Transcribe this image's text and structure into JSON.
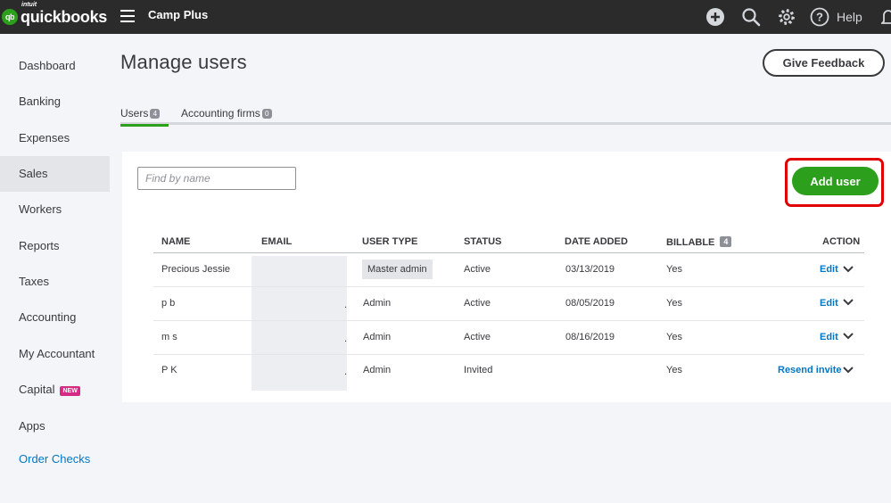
{
  "brand": {
    "intuit": "intuit",
    "name": "quickbooks",
    "mark": "qb"
  },
  "header": {
    "company": "Camp Plus",
    "help_label": "Help"
  },
  "top_icons": [
    "plus-circle-icon",
    "search-icon",
    "gear-icon",
    "help-icon",
    "bell-icon"
  ],
  "sidebar": {
    "items": [
      {
        "label": "Dashboard"
      },
      {
        "label": "Banking"
      },
      {
        "label": "Expenses"
      },
      {
        "label": "Sales",
        "active": true
      },
      {
        "label": "Workers"
      },
      {
        "label": "Reports"
      },
      {
        "label": "Taxes"
      },
      {
        "label": "Accounting"
      },
      {
        "label": "My Accountant"
      },
      {
        "label": "Capital",
        "badge": "NEW"
      },
      {
        "label": "Apps"
      },
      {
        "label": "Order Checks"
      }
    ]
  },
  "page": {
    "title": "Manage users",
    "feedback_label": "Give Feedback"
  },
  "tabs": [
    {
      "label": "Users",
      "count": "4",
      "active": true
    },
    {
      "label": "Accounting firms",
      "count": "0"
    }
  ],
  "search": {
    "placeholder": "Find by name",
    "value": ""
  },
  "add_user_label": "Add user",
  "table": {
    "columns": [
      "NAME",
      "EMAIL",
      "USER TYPE",
      "STATUS",
      "DATE ADDED",
      "BILLABLE",
      "ACTION"
    ],
    "billable_count": "4",
    "rows": [
      {
        "name": "Precious Jessie",
        "email": "",
        "user_type": "Master admin",
        "status": "Active",
        "date_added": "03/13/2019",
        "billable": "Yes",
        "action": "Edit"
      },
      {
        "name": "p b",
        "email": ".",
        "user_type": "Admin",
        "status": "Active",
        "date_added": "08/05/2019",
        "billable": "Yes",
        "action": "Edit"
      },
      {
        "name": "m s",
        "email": ".",
        "user_type": "Admin",
        "status": "Active",
        "date_added": "08/16/2019",
        "billable": "Yes",
        "action": "Edit"
      },
      {
        "name": "P K",
        "email": ".",
        "user_type": "Admin",
        "status": "Invited",
        "date_added": "",
        "billable": "Yes",
        "action": "Resend invite"
      }
    ]
  },
  "colors": {
    "brand_green": "#2ca01c",
    "link_blue": "#0077c5",
    "topbar": "#2b2b2b",
    "highlight_red": "#e00000",
    "new_badge": "#d52b84"
  }
}
